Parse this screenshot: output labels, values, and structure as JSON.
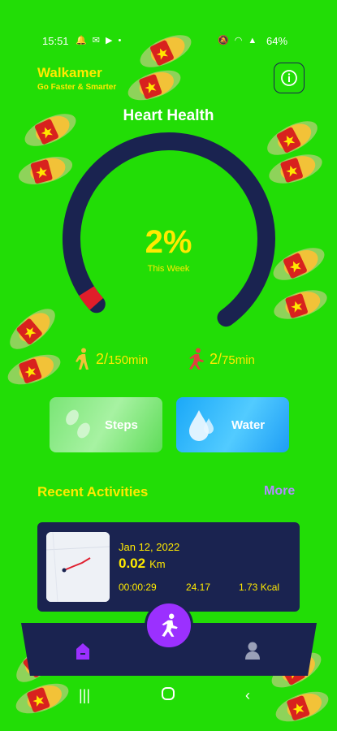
{
  "status": {
    "time": "15:51",
    "left_icons": "🔔 ✉ ▶ •",
    "right_icons": "🔕 ◠ ▲",
    "battery": "64%"
  },
  "header": {
    "title": "Walkamer",
    "subtitle": "Go Faster & Smarter"
  },
  "gauge": {
    "title": "Heart Health",
    "percent": "2%",
    "period": "This Week",
    "progress": 0.02
  },
  "stats": {
    "walk_value": "2/",
    "walk_target": "150min",
    "run_value": "2/",
    "run_target": "75min"
  },
  "cards": {
    "steps": "Steps",
    "water": "Water"
  },
  "recent": {
    "title": "Recent Activities",
    "more": "More"
  },
  "activity": {
    "date": "Jan 12, 2022",
    "distance": "0.02",
    "unit": "Km",
    "duration": "00:00:29",
    "pace": "24.17",
    "calories": "1.73 Kcal"
  },
  "colors": {
    "background": "#22dd06",
    "navy": "#1a2350",
    "accent_yellow": "#ffea00",
    "purple": "#9b30ff",
    "progress_red": "#e01e2a"
  }
}
